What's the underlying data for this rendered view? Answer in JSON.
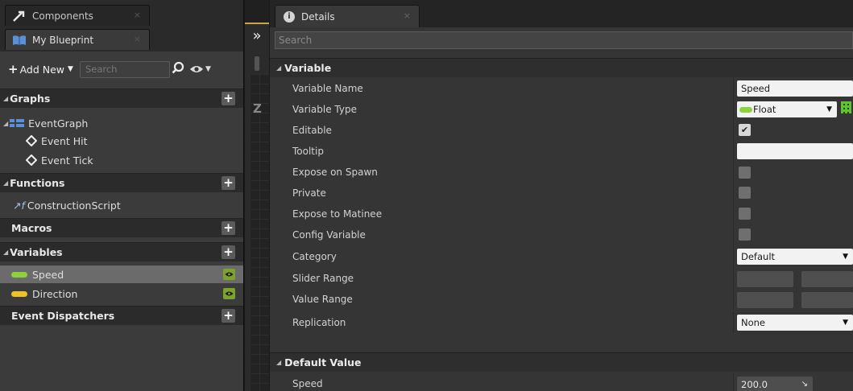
{
  "left_panel": {
    "tabs": {
      "components": "Components",
      "my_blueprint": "My Blueprint"
    },
    "toolbar": {
      "add_new_label": "Add New",
      "search_placeholder": "Search"
    },
    "categories": {
      "graphs": "Graphs",
      "functions": "Functions",
      "macros": "Macros",
      "variables": "Variables",
      "event_dispatchers": "Event Dispatchers"
    },
    "graphs_items": {
      "event_graph": "EventGraph",
      "event_hit": "Event Hit",
      "event_tick": "Event Tick"
    },
    "functions_items": {
      "construction_script": "ConstructionScript"
    },
    "variables_items": [
      {
        "label": "Speed",
        "type_color": "#8cd23c"
      },
      {
        "label": "Direction",
        "type_color": "#f0c028"
      }
    ]
  },
  "middle_strip": {
    "collapse_glyph": "»",
    "graph_letter": "Z"
  },
  "details": {
    "tab_label": "Details",
    "search_placeholder": "Search",
    "variable_section": "Variable",
    "rows": {
      "variable_name": {
        "label": "Variable Name",
        "value": "Speed"
      },
      "variable_type": {
        "label": "Variable Type",
        "value": "Float"
      },
      "editable": {
        "label": "Editable",
        "checked": true
      },
      "tooltip": {
        "label": "Tooltip",
        "value": ""
      },
      "expose_on_spawn": {
        "label": "Expose on Spawn",
        "checked": false
      },
      "private": {
        "label": "Private",
        "checked": false
      },
      "expose_to_matinee": {
        "label": "Expose to Matinee",
        "checked": false
      },
      "config_variable": {
        "label": "Config Variable",
        "checked": false
      },
      "category": {
        "label": "Category",
        "value": "Default"
      },
      "slider_range": {
        "label": "Slider Range"
      },
      "value_range": {
        "label": "Value Range"
      },
      "replication": {
        "label": "Replication",
        "value": "None"
      }
    },
    "default_value_section": "Default Value",
    "default_rows": {
      "speed": {
        "label": "Speed",
        "value": "200.0"
      }
    }
  },
  "colors": {
    "float_pin": "#8cd23c",
    "vector_pin": "#f0c028",
    "visibility_badge": "#7da32e"
  }
}
